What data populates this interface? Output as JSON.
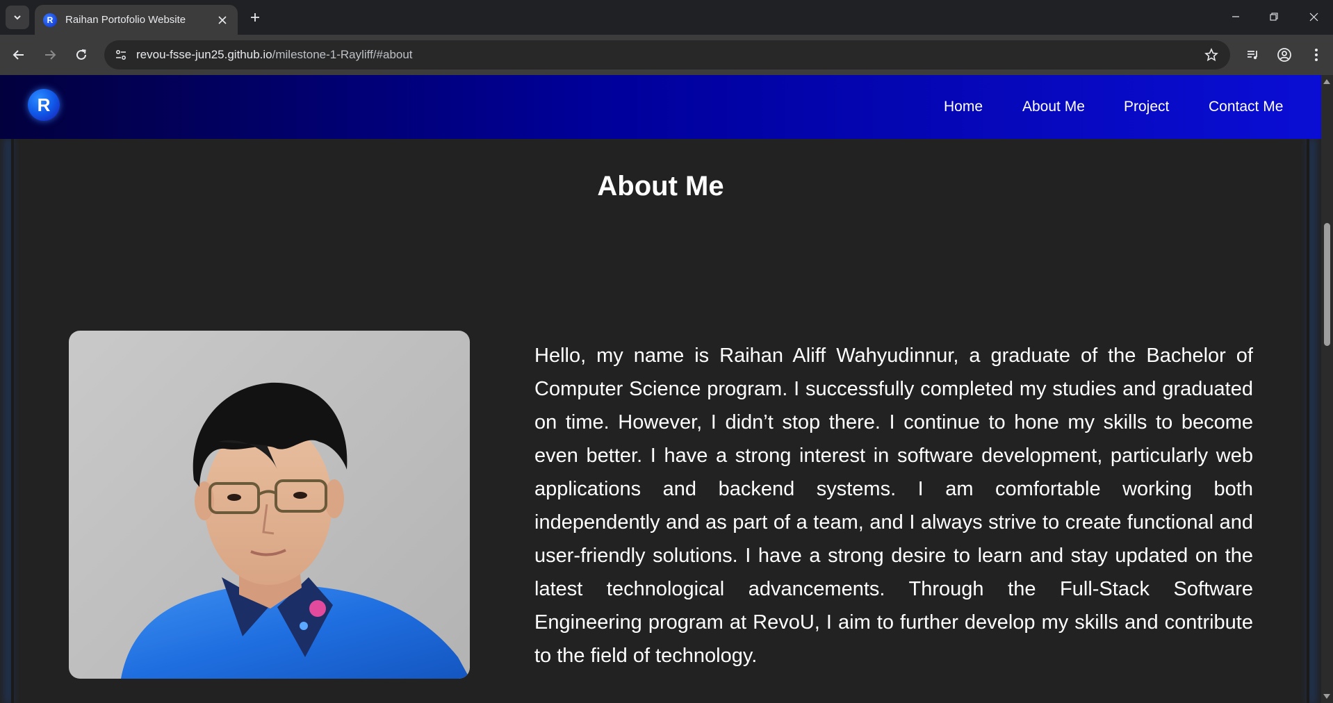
{
  "browser": {
    "tab_title": "Raihan Portofolio Website",
    "tab_favicon_letter": "R",
    "url_host": "revou-fsse-jun25.github.io",
    "url_path": "/milestone-1-Rayliff/#about"
  },
  "site": {
    "logo_letter": "R",
    "nav": [
      {
        "label": "Home"
      },
      {
        "label": "About Me"
      },
      {
        "label": "Project"
      },
      {
        "label": "Contact Me"
      }
    ],
    "accent_gradient": [
      "#02003d",
      "#00009a",
      "#0a0ed4"
    ]
  },
  "about": {
    "title": "About Me",
    "bio": "Hello, my name is Raihan Aliff Wahyudinnur, a graduate of the Bachelor of Computer Science program. I successfully completed my studies and graduated on time. However, I didn’t stop there. I continue to hone my skills to become even better. I have a strong interest in software development, particularly web applications and backend systems. I am comfortable working both independently and as part of a team, and I always strive to create functional and user-friendly solutions. I have a strong desire to learn and stay updated on the latest technological advancements. Through the Full-Stack Software Engineering program at RevoU, I aim to further develop my skills and contribute to the field of technology."
  }
}
